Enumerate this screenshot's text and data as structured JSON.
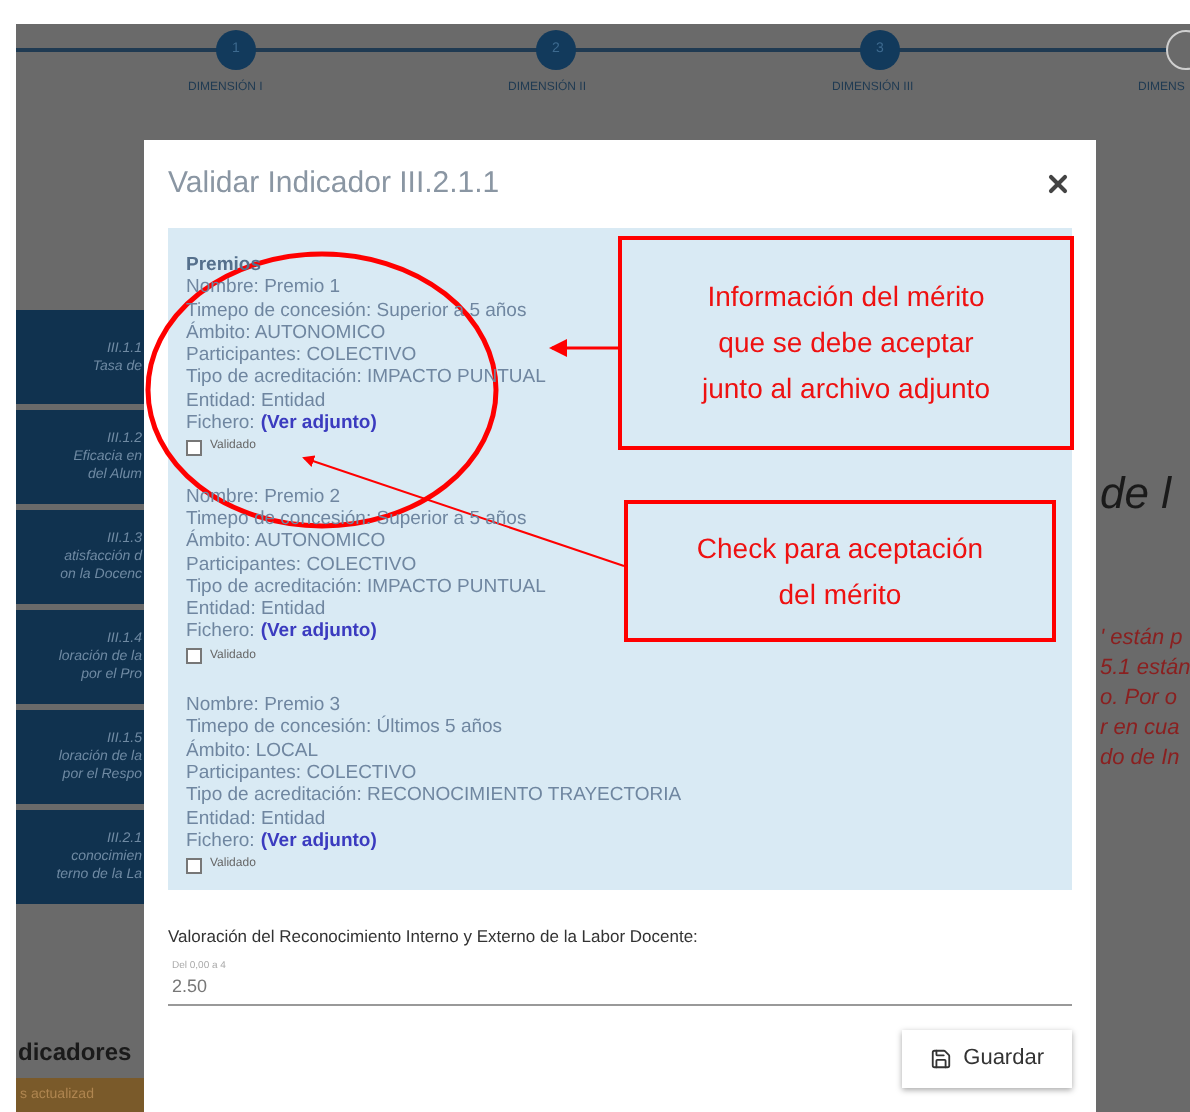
{
  "stepper": [
    {
      "number": "1",
      "label": "DIMENSIÓN I",
      "completed": true
    },
    {
      "number": "2",
      "label": "DIMENSIÓN II",
      "completed": true
    },
    {
      "number": "3",
      "label": "DIMENSIÓN III",
      "completed": true
    },
    {
      "label": "DIMENS",
      "completed": false
    }
  ],
  "sidebar": {
    "items": [
      {
        "code": "III.1.1",
        "lines": [
          "Tasa de"
        ]
      },
      {
        "code": "III.1.2",
        "lines": [
          "Eficacia en",
          "del Alum"
        ]
      },
      {
        "code": "III.1.3",
        "lines": [
          "atisfacción d",
          "on la Docenc"
        ]
      },
      {
        "code": "III.1.4",
        "lines": [
          "loración de la",
          "por el Pro"
        ]
      },
      {
        "code": "III.1.5",
        "lines": [
          "loración de la",
          "por el Respo"
        ]
      },
      {
        "code": "III.2.1",
        "lines": [
          "conocimien",
          "terno de la La"
        ]
      }
    ]
  },
  "background_heading": "dicadores",
  "background_button": "s actualizad",
  "right_heading": "de l",
  "right_notes": [
    "' están p",
    "5.1 están",
    "o. Por o",
    "r en cua",
    "do de In"
  ],
  "modal": {
    "title": "Validar Indicador III.2.1.1",
    "section_title": "Premios",
    "merits": [
      {
        "lines": [
          "Nombre: Premio 1",
          "Timepo de concesión: Superior a 5 años",
          "Ámbito: AUTONOMICO",
          "Participantes: COLECTIVO",
          "Tipo de acreditación: IMPACTO PUNTUAL",
          "Entidad: Entidad"
        ],
        "file_label": "Fichero:",
        "file_link": "(Ver adjunto)",
        "check_label": "Validado",
        "checked": false
      },
      {
        "lines": [
          "Nombre: Premio 2",
          "Timepo de concesión: Superior a 5 años",
          "Ámbito: AUTONOMICO",
          "Participantes: COLECTIVO",
          "Tipo de acreditación: IMPACTO PUNTUAL",
          "Entidad: Entidad"
        ],
        "file_label": "Fichero:",
        "file_link": "(Ver adjunto)",
        "check_label": "Validado",
        "checked": false
      },
      {
        "lines": [
          "Nombre: Premio 3",
          "Timepo de concesión: Últimos 5 años",
          "Ámbito: LOCAL",
          "Participantes: COLECTIVO",
          "Tipo de acreditación: RECONOCIMIENTO TRAYECTORIA",
          "Entidad: Entidad"
        ],
        "file_label": "Fichero:",
        "file_link": "(Ver adjunto)",
        "check_label": "Validado",
        "checked": false
      }
    ],
    "rating_label": "Valoración del Reconocimiento Interno y Externo de la Labor Docente:",
    "rating_field": {
      "placeholder": "Del 0,00 a 4",
      "value": "2.50"
    },
    "save_button": "Guardar"
  },
  "annotations": [
    {
      "lines": [
        "Información del mérito",
        "que se debe aceptar",
        "junto al archivo adjunto"
      ]
    },
    {
      "lines": [
        "Check para aceptación",
        "del  mérito"
      ]
    }
  ]
}
